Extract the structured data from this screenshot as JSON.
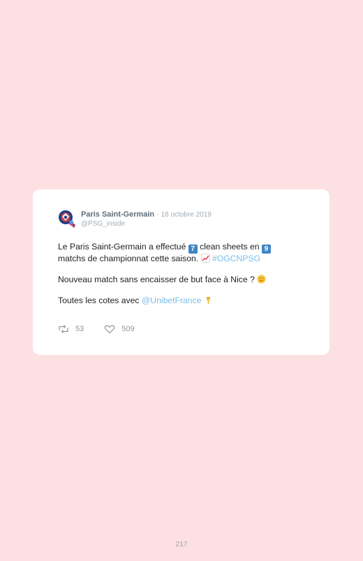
{
  "tweet": {
    "author_name": "Paris Saint-Germain",
    "separator": "·",
    "date": "18 octobre 2019",
    "handle": "@PSG_inside",
    "line1": {
      "text_a": "Le Paris Saint-Germain a effectué ",
      "emoji_seven": "7",
      "text_b": " clean sheets en ",
      "emoji_nine": "9"
    },
    "line2": {
      "text_a": "matchs de championnat cette saison. ",
      "hashtag": "#OGCNPSG"
    },
    "paragraph2": {
      "text": "Nouveau match sans encaisser de but face à Nice ? "
    },
    "paragraph3": {
      "text": "Toutes les cotes avec ",
      "mention": "@UnibetFrance"
    },
    "retweet_count": "53",
    "like_count": "509"
  },
  "page": {
    "number": "217"
  },
  "icons": {
    "avatar": "psg-crest-icon",
    "retweet": "retweet-icon",
    "like": "heart-icon",
    "keycap_seven": "keycap-seven-icon",
    "keycap_nine": "keycap-nine-icon",
    "chart": "chart-increasing-icon",
    "thinking": "thinking-face-icon",
    "pointing": "backhand-index-pointing-down-icon"
  },
  "colors": {
    "background": "#fde0e1",
    "card": "#ffffff",
    "link": "#76bfe8",
    "text": "#1c1f23",
    "muted": "#a3adb6"
  }
}
